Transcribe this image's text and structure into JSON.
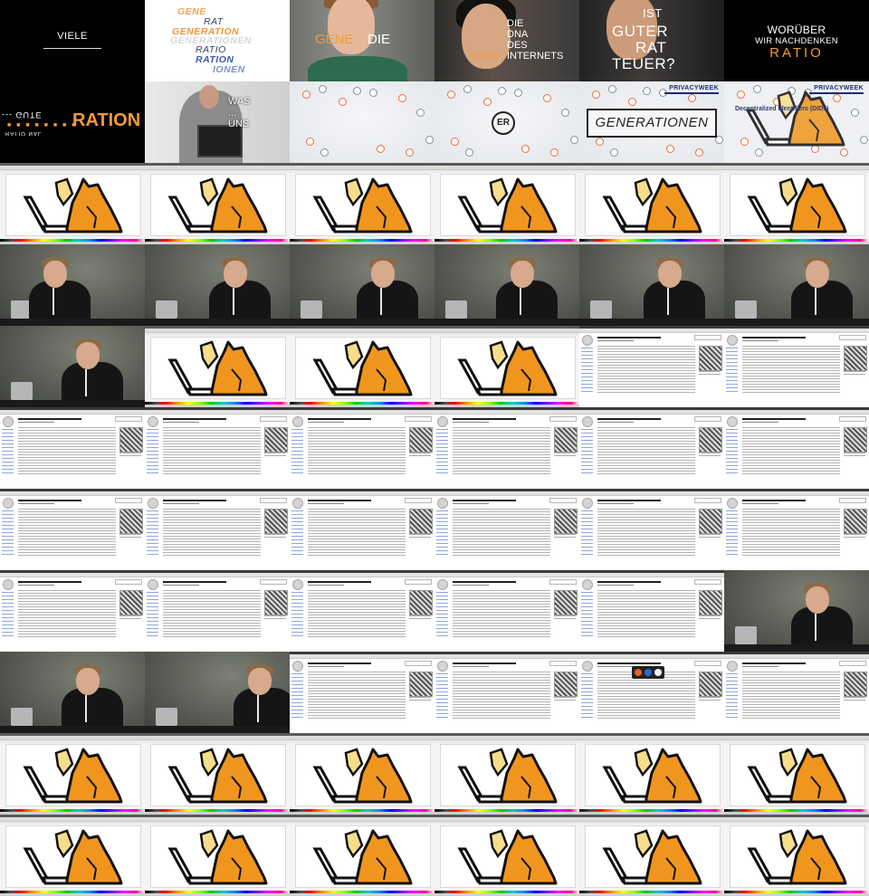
{
  "intro": {
    "viele": "VIELE",
    "wordcloud": [
      "GENE",
      "RAT",
      "GENERATION",
      "GENERATIONEN",
      "RATIO",
      "RATION",
      "IONEN"
    ],
    "boy_card": {
      "gene": "GENE",
      "die": "DIE"
    },
    "girl_card": {
      "lines": [
        "DIE",
        "DNA",
        "DES",
        "INTERNETS"
      ],
      "gene": "GENE"
    },
    "rat_card": {
      "lines": [
        "IST",
        "GUTER",
        "RAT",
        "TEUER?"
      ]
    },
    "worueber": {
      "line1": "WORÜBER",
      "line2": "WIR NACHDENKEN",
      "ratio": "RATIO"
    },
    "ration": "RATION",
    "tablet_overlay": [
      "WAS",
      "...",
      "UNS"
    ],
    "generationen_box": "GENERATIONEN",
    "er_logo": "ER",
    "privacyweek": "PRIVACYWEEK",
    "did_title": "Decentralized Identifiers (DIDs)"
  },
  "colors": {
    "accent_orange": "#f39a3a",
    "navy": "#1c2d6e",
    "cat_orange": "#f0961e",
    "cat_light": "#f6dd8c"
  },
  "sequence": [
    "viele",
    "wordcloud",
    "boy",
    "girl",
    "rat",
    "worueber",
    "ration",
    "tablet",
    "network",
    "network-er",
    "network-gen",
    "did",
    "ink",
    "ink",
    "ink",
    "ink",
    "ink",
    "ink",
    "speaker",
    "speaker",
    "speaker",
    "speaker",
    "speaker",
    "speaker",
    "speaker",
    "ink",
    "ink",
    "ink",
    "wiki",
    "wiki",
    "wiki",
    "wiki",
    "wiki",
    "wiki",
    "wiki",
    "wiki",
    "wiki",
    "wiki",
    "wiki",
    "wiki",
    "wiki",
    "wiki",
    "wiki",
    "wiki",
    "wiki",
    "wiki",
    "wiki",
    "speaker",
    "speaker",
    "speaker-stand",
    "wiki",
    "wiki",
    "wiki-popup",
    "wiki",
    "ink",
    "ink",
    "ink",
    "ink",
    "ink",
    "ink",
    "ink",
    "ink",
    "ink",
    "ink",
    "ink",
    "ink"
  ]
}
